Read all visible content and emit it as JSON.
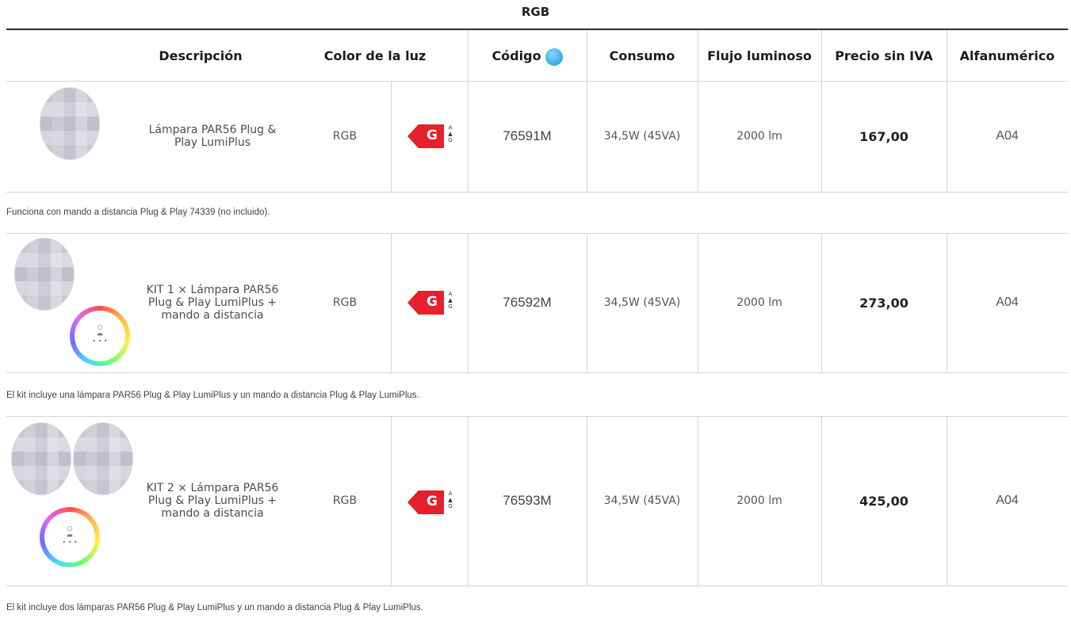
{
  "title": "RGB",
  "headers": {
    "descripcion": "Descripción",
    "color": "Color de la luz",
    "codigo": "Código",
    "consumo": "Consumo",
    "flujo": "Flujo luminoso",
    "precio": "Precio sin IVA",
    "alfa": "Alfanumérico"
  },
  "rows": [
    {
      "desc_lines": [
        "Lámpara PAR56 Plug &",
        "Play LumiPlus"
      ],
      "color": "RGB",
      "energy_class": "G",
      "code": "76591M",
      "consumo": "34,5W (45VA)",
      "flujo": "2000 lm",
      "precio": "167,00",
      "alfa": "A04",
      "note": "Funciona con mando a distancia Plug & Play 74339 (no incluido)."
    },
    {
      "desc_lines": [
        "KIT 1 × Lámpara PAR56",
        "Plug & Play LumiPlus +",
        "mando a distancia"
      ],
      "color": "RGB",
      "energy_class": "G",
      "code": "76592M",
      "consumo": "34,5W (45VA)",
      "flujo": "2000 lm",
      "precio": "273,00",
      "alfa": "A04",
      "note": "El kit incluye una lámpara PAR56 Plug & Play LumiPlus y un mando a distancia Plug & Play LumiPlus."
    },
    {
      "desc_lines": [
        "KIT 2 × Lámpara PAR56",
        "Plug & Play LumiPlus +",
        "mando a distancia"
      ],
      "color": "RGB",
      "energy_class": "G",
      "code": "76593M",
      "consumo": "34,5W (45VA)",
      "flujo": "2000 lm",
      "precio": "425,00",
      "alfa": "A04",
      "note": "El kit incluye dos lámparas PAR56 Plug & Play LumiPlus y un mando a distancia Plug & Play LumiPlus."
    }
  ],
  "energy_scale": {
    "top": "A",
    "bottom": "G"
  },
  "icons": {
    "water_drop": "water-drop-icon"
  },
  "colors": {
    "energy_red": "#e4202a",
    "drop_blue": "#3db4ec"
  }
}
